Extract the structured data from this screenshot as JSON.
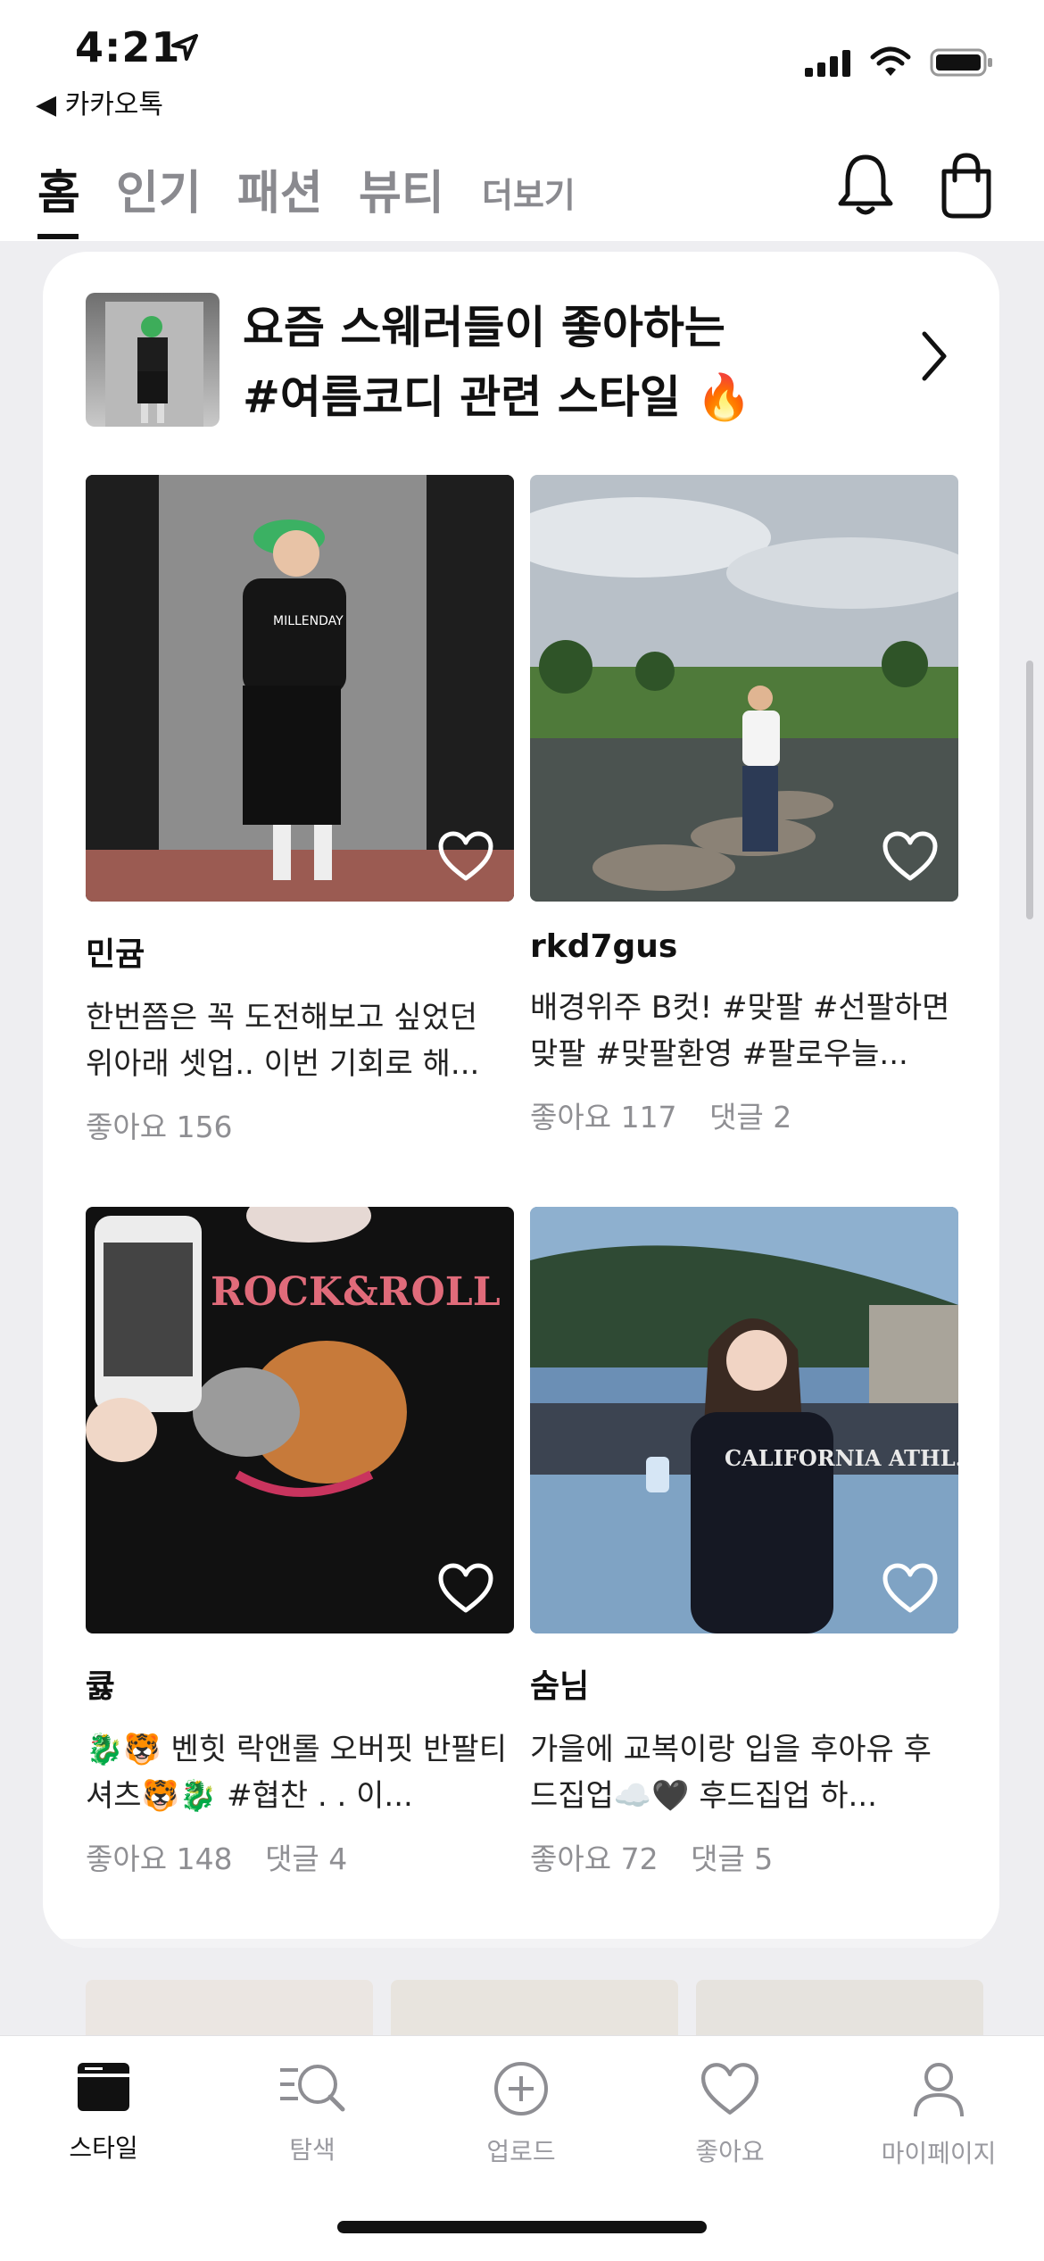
{
  "status_bar": {
    "time": "4:21",
    "back_app": "◀ 카카오톡"
  },
  "top_nav": {
    "tabs": [
      {
        "label": "홈",
        "active": true
      },
      {
        "label": "인기",
        "active": false
      },
      {
        "label": "패션",
        "active": false
      },
      {
        "label": "뷰티",
        "active": false
      }
    ],
    "more_label": "더보기",
    "icons": [
      "bell-icon",
      "shopping-bag-icon"
    ]
  },
  "feature": {
    "title_line1": "요즘 스웨러들이 좋아하는",
    "title_line2": "#여름코디 관련 스타일 🔥"
  },
  "posts": [
    {
      "user": "민귬",
      "text": "한번쯤은 꼭 도전해보고 싶었던 위아래 셋업.. 이번 기회로 해...",
      "likes": "좋아요 156",
      "comments": ""
    },
    {
      "user": "rkd7gus",
      "text": "배경위주 B컷! #맞팔 #선팔하면맞팔 #맞팔환영 #팔로우늘...",
      "likes": "좋아요 117",
      "comments": "댓글 2"
    },
    {
      "user": "큟",
      "text": "🐉🐯 벤힛 락앤롤 오버핏 반팔티셔츠🐯🐉 #협찬 . . 이...",
      "likes": "좋아요 148",
      "comments": "댓글 4"
    },
    {
      "user": "숨님",
      "text": "가을에 교복이랑 입을 후아유 후드집업☁️🖤 후드집업 하...",
      "likes": "좋아요 72",
      "comments": "댓글 5"
    }
  ],
  "post_image_texts": [
    "MILLENDAY",
    "ROCK&ROLL",
    "CALIFORNIA ATHL. CLUB"
  ],
  "bottom_tabs": [
    {
      "label": "스타일",
      "icon": "style-icon",
      "active": true
    },
    {
      "label": "탐색",
      "icon": "explore-icon",
      "active": false
    },
    {
      "label": "업로드",
      "icon": "upload-icon",
      "active": false
    },
    {
      "label": "좋아요",
      "icon": "heart-icon",
      "active": false
    },
    {
      "label": "마이페이지",
      "icon": "profile-icon",
      "active": false
    }
  ],
  "colors": {
    "accent": "#111111",
    "muted": "#8f8f93",
    "background": "#eeeef1"
  }
}
